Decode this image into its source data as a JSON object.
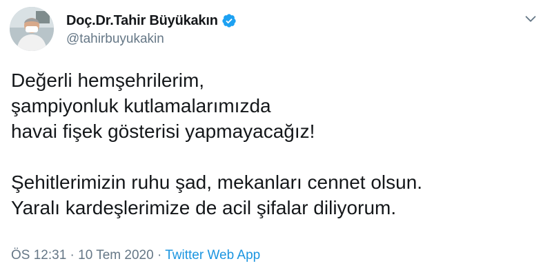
{
  "author": {
    "display_name": "Doç.Dr.Tahir Büyükakın",
    "handle": "@tahirbuyukakin",
    "verified": true
  },
  "tweet": {
    "lines": [
      "Değerli hemşehrilerim,",
      "şampiyonluk kutlamalarımızda",
      "havai fişek gösterisi yapmayacağız!",
      "Şehitlerimizin ruhu şad, mekanları cennet olsun.",
      "Yaralı kardeşlerimize de acil şifalar diliyorum."
    ]
  },
  "meta": {
    "time": "ÖS 12:31",
    "separator": " · ",
    "date": "10 Tem 2020",
    "source": "Twitter Web App"
  },
  "icons": {
    "verified": "verified-badge-icon",
    "menu": "chevron-down-icon"
  },
  "colors": {
    "verified": "#1da1f2",
    "secondary_text": "#657786",
    "link": "#1b95e0",
    "primary_text": "#14171a"
  }
}
